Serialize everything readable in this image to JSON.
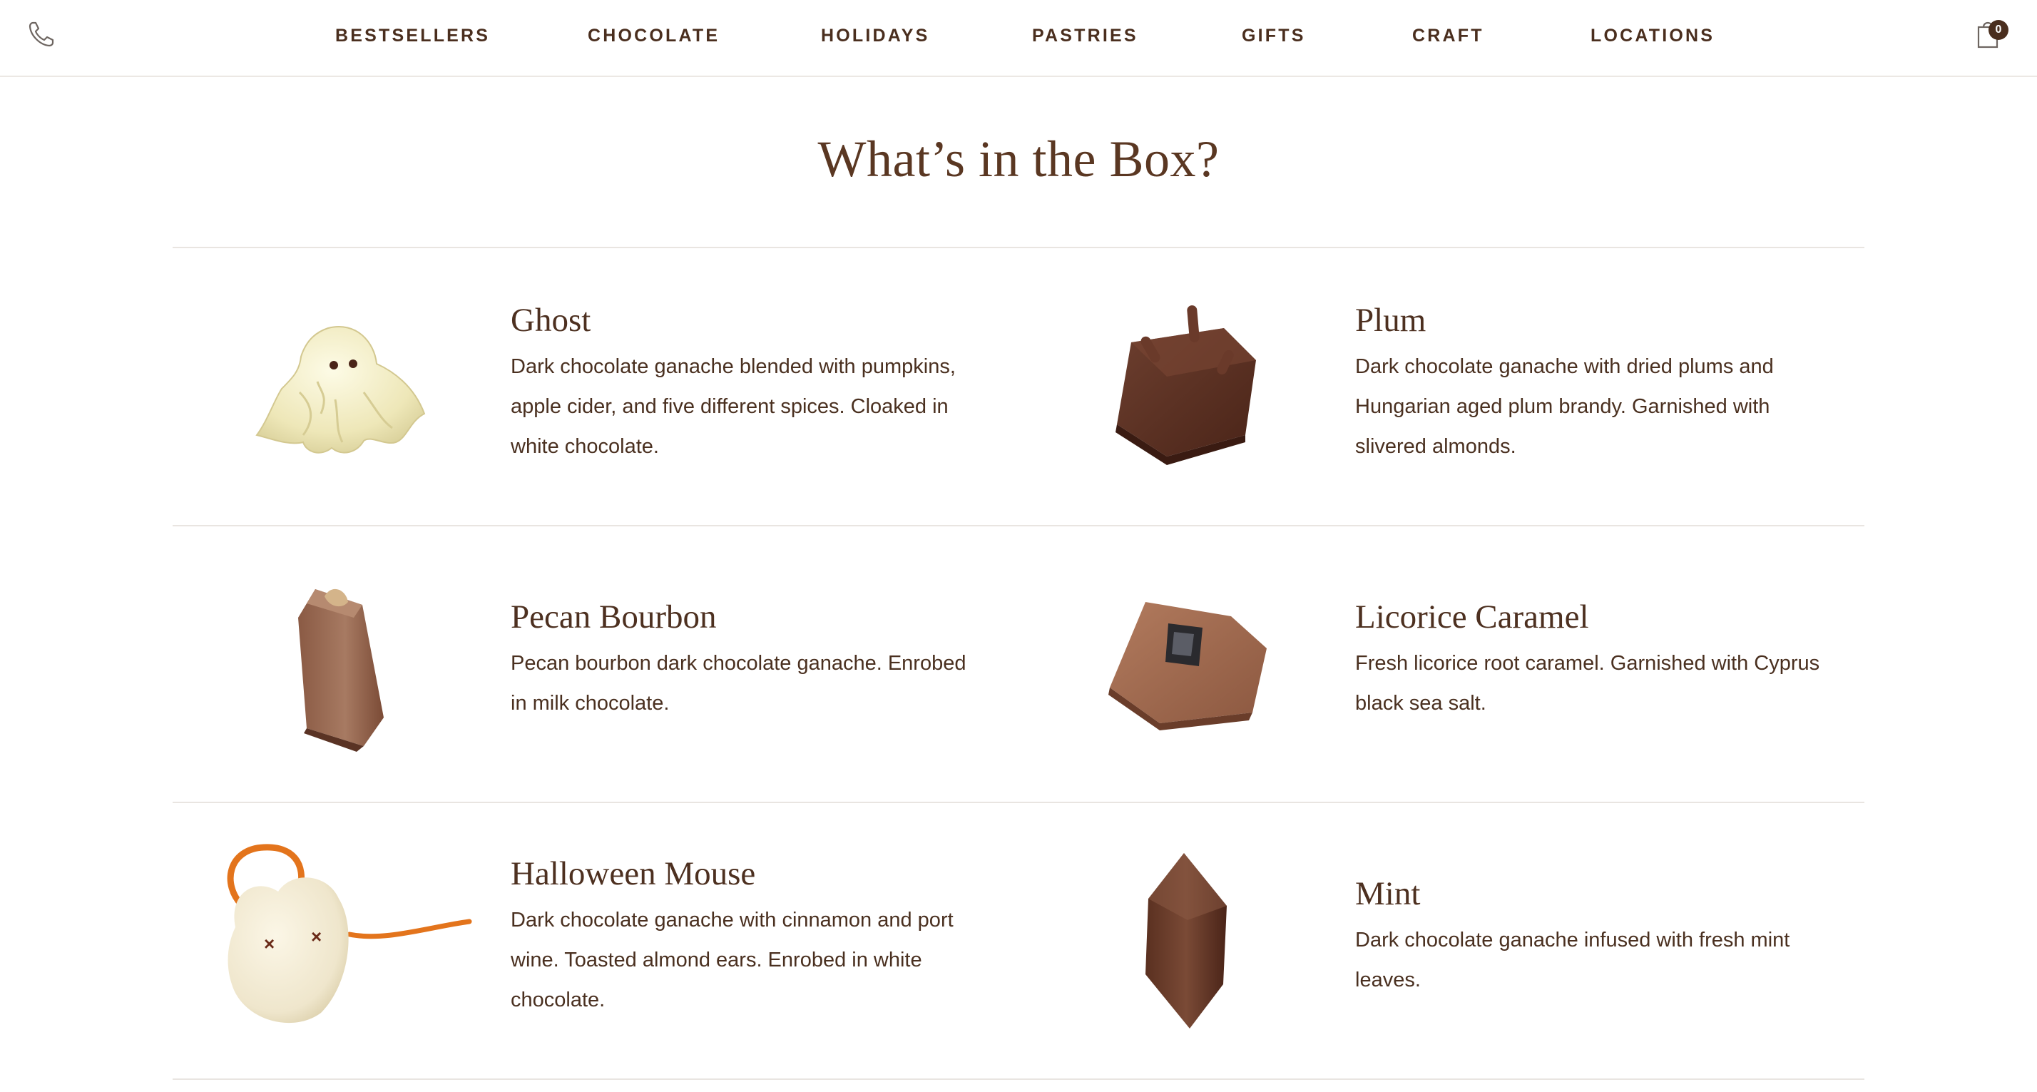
{
  "nav": {
    "items": [
      {
        "label": "BESTSELLERS"
      },
      {
        "label": "CHOCOLATE"
      },
      {
        "label": "HOLIDAYS"
      },
      {
        "label": "PASTRIES"
      },
      {
        "label": "GIFTS"
      },
      {
        "label": "CRAFT"
      },
      {
        "label": "LOCATIONS"
      }
    ],
    "phone_icon": "phone-icon",
    "cart_icon": "shopping-bag-icon",
    "cart_count": "0"
  },
  "section": {
    "title": "What’s in the Box?"
  },
  "items": [
    {
      "name": "Ghost",
      "description": "Dark chocolate ganache blended with pumpkins, apple cider, and five different spices. Cloaked in white chocolate.",
      "image": "ghost-chocolate-image"
    },
    {
      "name": "Plum",
      "description": "Dark chocolate ganache with dried plums and Hungarian aged plum brandy. Garnished with slivered almonds.",
      "image": "plum-chocolate-image"
    },
    {
      "name": "Pecan Bourbon",
      "description": "Pecan bourbon dark chocolate ganache. Enrobed in milk chocolate.",
      "image": "pecan-bourbon-chocolate-image"
    },
    {
      "name": "Licorice Caramel",
      "description": "Fresh licorice root caramel. Garnished with Cyprus black sea salt.",
      "image": "licorice-caramel-chocolate-image"
    },
    {
      "name": "Halloween Mouse",
      "description": "Dark chocolate ganache with cinnamon and port wine. Toasted almond ears. Enrobed in white chocolate.",
      "image": "halloween-mouse-chocolate-image"
    },
    {
      "name": "Mint",
      "description": "Dark chocolate ganache infused with fresh mint leaves.",
      "image": "mint-chocolate-image"
    }
  ],
  "colors": {
    "brand_brown": "#4a2e1e",
    "divider": "#e9e5e1"
  }
}
